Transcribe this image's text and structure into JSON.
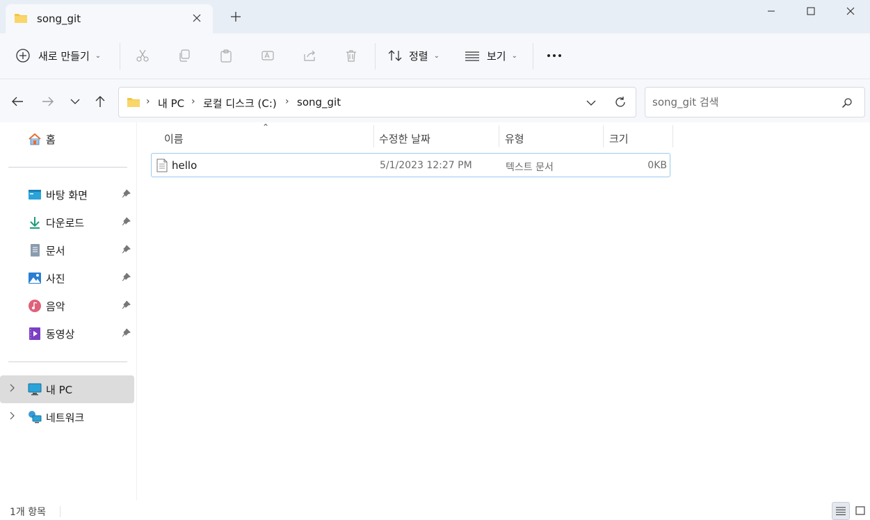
{
  "tab": {
    "title": "song_git"
  },
  "toolbar": {
    "new_label": "새로 만들기",
    "sort_label": "정렬",
    "view_label": "보기"
  },
  "address": {
    "crumbs": [
      "내 PC",
      "로컬 디스크 (C:)",
      "song_git"
    ]
  },
  "search": {
    "placeholder": "song_git 검색"
  },
  "sidebar": {
    "home": "홈",
    "quick_access": [
      {
        "label": "바탕 화면",
        "icon": "desktop-icon"
      },
      {
        "label": "다운로드",
        "icon": "download-icon"
      },
      {
        "label": "문서",
        "icon": "document-icon"
      },
      {
        "label": "사진",
        "icon": "picture-icon"
      },
      {
        "label": "음악",
        "icon": "music-icon"
      },
      {
        "label": "동영상",
        "icon": "video-icon"
      }
    ],
    "this_pc": "내 PC",
    "network": "네트워크"
  },
  "columns": {
    "name": "이름",
    "modified": "수정한 날짜",
    "type": "유형",
    "size": "크기"
  },
  "files": [
    {
      "name": "hello",
      "modified": "5/1/2023 12:27 PM",
      "type": "텍스트 문서",
      "size": "0KB"
    }
  ],
  "status": {
    "count": "1개 항목"
  },
  "colors": {
    "folder": "#f4c542",
    "accent": "#0067c0",
    "selected_border": "#99c9ef"
  }
}
